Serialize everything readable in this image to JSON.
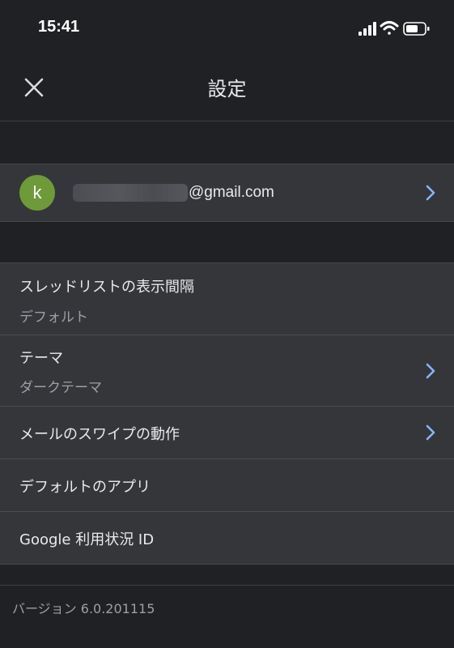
{
  "status_bar": {
    "time": "15:41",
    "icons": [
      "signal-icon",
      "wifi-icon",
      "battery-icon"
    ]
  },
  "header": {
    "title": "設定",
    "close_icon": "close-icon"
  },
  "account": {
    "avatar_letter": "k",
    "avatar_color": "#6f9a3a",
    "email_domain": "@gmail.com",
    "chevron_color": "#8ab4f8"
  },
  "settings": [
    {
      "label": "スレッドリストの表示間隔",
      "value": "デフォルト",
      "has_chevron": false
    },
    {
      "label": "テーマ",
      "value": "ダークテーマ",
      "has_chevron": true
    },
    {
      "label": "メールのスワイプの動作",
      "has_chevron": true
    },
    {
      "label": "デフォルトのアプリ",
      "has_chevron": false
    },
    {
      "label": "Google 利用状況 ID",
      "has_chevron": false
    }
  ],
  "footer": {
    "version": "バージョン 6.0.201115"
  }
}
